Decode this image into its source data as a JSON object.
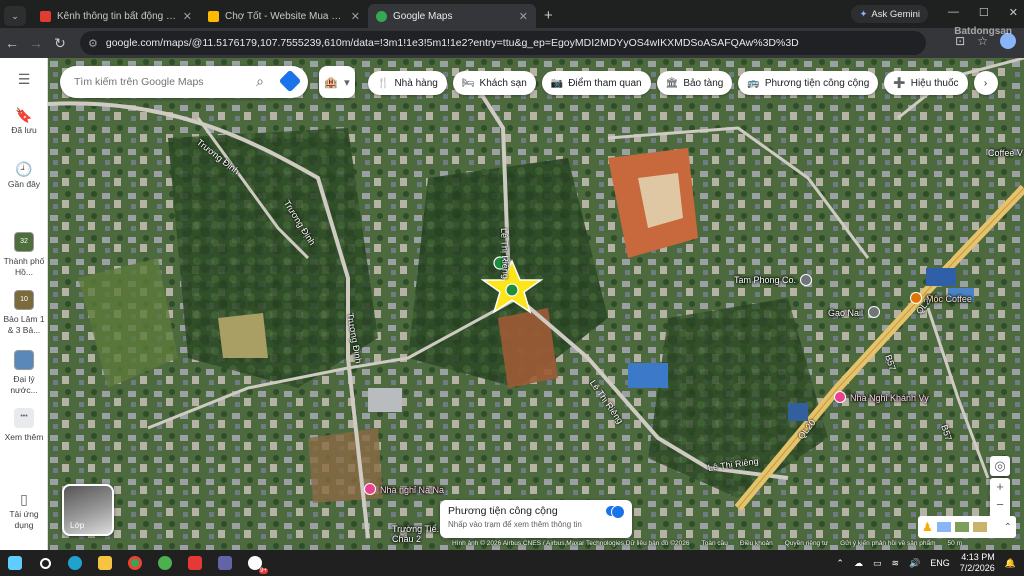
{
  "browser": {
    "tabs": [
      {
        "title": "Kênh thông tin bất động sản - N",
        "favicon_color": "#e03c31"
      },
      {
        "title": "Chợ Tốt - Website Mua Bán, Rao",
        "favicon_color": "#ffba00"
      },
      {
        "title": "Google Maps",
        "favicon_color": "#34a853"
      }
    ],
    "ask_gemini": "Ask Gemini",
    "url": "google.com/maps/@11.5176179,107.7555239,610m/data=!3m1!1e3!5m1!1e2?entry=ttu&g_ep=EgoyMDI2MDYyOS4wIKXMDSoASAFQAw%3D%3D",
    "watermark": "Batdongsan"
  },
  "left_panel": {
    "saved": "Đã lưu",
    "recent": "Gần đây",
    "recent_places": [
      {
        "badge": "32",
        "label": "Thành phố Hồ..."
      },
      {
        "badge": "10",
        "label": "Bảo Lâm 1 & 3 Bả..."
      },
      {
        "badge": "",
        "label": "Đại lý nước..."
      }
    ],
    "more": "Xem thêm",
    "download": "Tải ứng dụng"
  },
  "search": {
    "placeholder": "Tìm kiếm trên Google Maps"
  },
  "chips": [
    {
      "icon": "restaurant-icon",
      "glyph": "🍴",
      "label": "Nhà hàng"
    },
    {
      "icon": "hotel-icon",
      "glyph": "🛏",
      "label": "Khách sạn"
    },
    {
      "icon": "camera-icon",
      "glyph": "📷",
      "label": "Điểm tham quan"
    },
    {
      "icon": "museum-icon",
      "glyph": "🏛",
      "label": "Bảo tàng"
    },
    {
      "icon": "transit-icon",
      "glyph": "🚌",
      "label": "Phương tiện công cộng"
    },
    {
      "icon": "pharmacy-icon",
      "glyph": "➕",
      "label": "Hiệu thuốc"
    }
  ],
  "map": {
    "roads": [
      {
        "text": "Trương Định"
      },
      {
        "text": "Trương Định"
      },
      {
        "text": "Trương Định"
      },
      {
        "text": "Lê Thị Riêng"
      },
      {
        "text": "Lê Thị Riêng"
      },
      {
        "text": "Lê Thị Riêng"
      },
      {
        "text": "QL20"
      },
      {
        "text": "QL20"
      },
      {
        "text": "B57"
      },
      {
        "text": "B57"
      }
    ],
    "places": [
      {
        "text": "Tam Phong Co.",
        "kind": "w"
      },
      {
        "text": "Gạo Nail",
        "kind": "w"
      },
      {
        "text": "Mộc Coffee",
        "kind": "o"
      },
      {
        "text": "Nhà Nghỉ Khánh Vy",
        "kind": "p"
      },
      {
        "text": "Nhà nghỉ Na Na",
        "kind": "p"
      },
      {
        "text": "Coffee V",
        "kind": "w"
      },
      {
        "text": "Trường Tiể... Học Lộc Châu 2",
        "kind": "w"
      }
    ],
    "layer_label": "Lớp",
    "transit_card": {
      "title": "Phương tiện công cộng",
      "subtitle": "Nhấp vào trạm để xem thêm thông tin"
    },
    "attribution": [
      "Hình ảnh © 2026 Airbus,CNES / Airbus,Maxar Technologies,Dữ liệu bản đồ ©2026",
      "Toàn cầu",
      "Điều khoản",
      "Quyền riêng tư",
      "Gửi ý kiến phản hồi về sản phẩm",
      "50 m"
    ]
  },
  "taskbar": {
    "lang": "ENG",
    "time": "4:13 PM",
    "date": "7/2/2026",
    "badge": "9+"
  }
}
